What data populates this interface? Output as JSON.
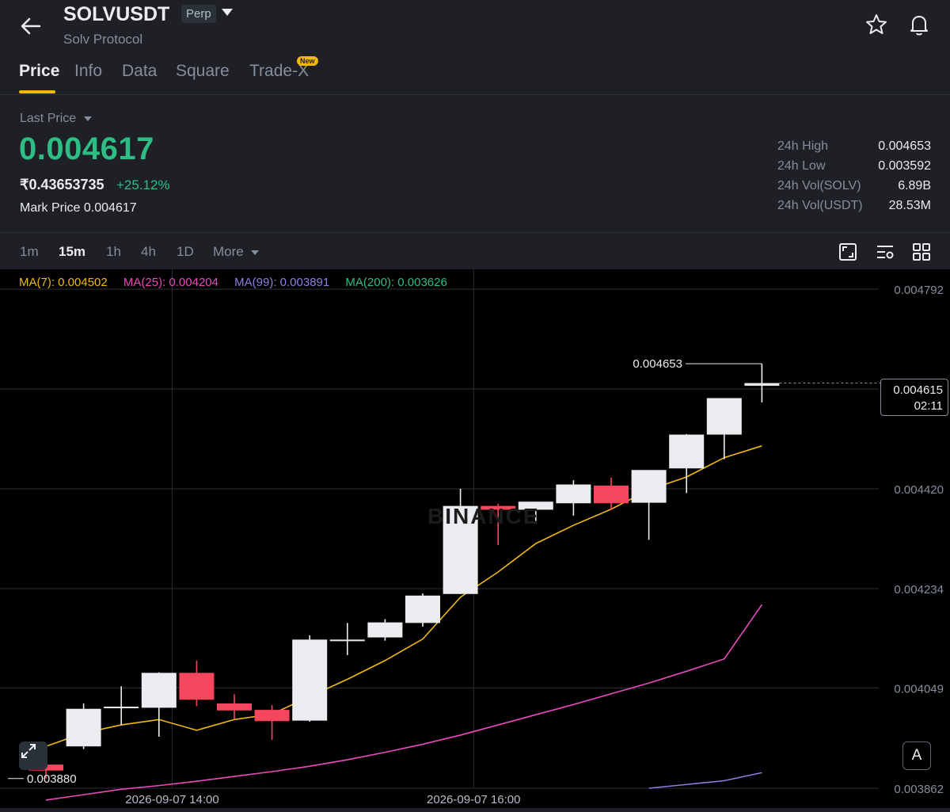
{
  "header": {
    "symbol": "SOLVUSDT",
    "badge": "Perp",
    "subname": "Solv Protocol"
  },
  "tabs": [
    {
      "label": "Price",
      "active": true
    },
    {
      "label": "Info",
      "active": false
    },
    {
      "label": "Data",
      "active": false
    },
    {
      "label": "Square",
      "active": false
    },
    {
      "label": "Trade-X",
      "active": false,
      "badge": "New"
    }
  ],
  "price": {
    "label": "Last Price",
    "last": "0.004617",
    "inr": "₹0.43653735",
    "change": "+25.12%",
    "mark_label": "Mark Price",
    "mark_value": "0.004617"
  },
  "stats": [
    {
      "label": "24h High",
      "value": "0.004653"
    },
    {
      "label": "24h Low",
      "value": "0.003592"
    },
    {
      "label": "24h Vol(SOLV)",
      "value": "6.89B"
    },
    {
      "label": "24h Vol(USDT)",
      "value": "28.53M"
    }
  ],
  "intervals": [
    {
      "label": "1m",
      "active": false
    },
    {
      "label": "15m",
      "active": true
    },
    {
      "label": "1h",
      "active": false
    },
    {
      "label": "4h",
      "active": false
    },
    {
      "label": "1D",
      "active": false
    },
    {
      "label": "More",
      "active": false
    }
  ],
  "ma_legend": [
    {
      "label": "MA(7): 0.004502",
      "color": "#f0b90b"
    },
    {
      "label": "MA(25): 0.004204",
      "color": "#e94bbd"
    },
    {
      "label": "MA(99): 0.003891",
      "color": "#8c7fe0"
    },
    {
      "label": "MA(200): 0.003626",
      "color": "#2ebd85"
    }
  ],
  "colors": {
    "up": "#eaecef",
    "down": "#f6465d",
    "ma7": "#f0b90b",
    "ma25": "#e94bbd",
    "ma99": "#8c7fe0"
  },
  "watermark": "BINANCE",
  "current_price": {
    "value": "0.004615",
    "countdown": "02:11"
  },
  "annotations": {
    "high": "0.004653",
    "low": "0.003880"
  },
  "a_button": "A",
  "chart_data": {
    "type": "candlestick",
    "interval": "15m",
    "ylim": [
      0.003862,
      0.004792
    ],
    "y_ticks": [
      "0.004792",
      "0.004420",
      "0.004234",
      "0.004049",
      "0.003862"
    ],
    "x_ticks": [
      "2026-09-07 14:00",
      "2026-09-07 16:00"
    ],
    "candles": [
      {
        "o": 0.003906,
        "h": 0.003906,
        "l": 0.00388,
        "c": 0.003895
      },
      {
        "o": 0.00394,
        "h": 0.00402,
        "l": 0.003935,
        "c": 0.00401
      },
      {
        "o": 0.004012,
        "h": 0.004052,
        "l": 0.00398,
        "c": 0.004014
      },
      {
        "o": 0.004012,
        "h": 0.004078,
        "l": 0.003958,
        "c": 0.004077
      },
      {
        "o": 0.004077,
        "h": 0.0041,
        "l": 0.004015,
        "c": 0.004027
      },
      {
        "o": 0.00402,
        "h": 0.004037,
        "l": 0.00399,
        "c": 0.004007
      },
      {
        "o": 0.004008,
        "h": 0.004017,
        "l": 0.003952,
        "c": 0.003987
      },
      {
        "o": 0.003988,
        "h": 0.004147,
        "l": 0.003986,
        "c": 0.004139
      },
      {
        "o": 0.004137,
        "h": 0.00417,
        "l": 0.00411,
        "c": 0.004139
      },
      {
        "o": 0.004143,
        "h": 0.004177,
        "l": 0.004137,
        "c": 0.004171
      },
      {
        "o": 0.00417,
        "h": 0.004225,
        "l": 0.004163,
        "c": 0.004221
      },
      {
        "o": 0.004224,
        "h": 0.00442,
        "l": 0.004224,
        "c": 0.004388
      },
      {
        "o": 0.004388,
        "h": 0.004392,
        "l": 0.004315,
        "c": 0.004381
      },
      {
        "o": 0.004381,
        "h": 0.004396,
        "l": 0.00436,
        "c": 0.004396
      },
      {
        "o": 0.004393,
        "h": 0.004436,
        "l": 0.00437,
        "c": 0.004428
      },
      {
        "o": 0.004426,
        "h": 0.004441,
        "l": 0.00438,
        "c": 0.004393
      },
      {
        "o": 0.004394,
        "h": 0.004433,
        "l": 0.004325,
        "c": 0.004455
      },
      {
        "o": 0.004458,
        "h": 0.004522,
        "l": 0.004412,
        "c": 0.004521
      },
      {
        "o": 0.004521,
        "h": 0.004539,
        "l": 0.004475,
        "c": 0.004589
      },
      {
        "o": 0.004612,
        "h": 0.004653,
        "l": 0.004581,
        "c": 0.004617
      }
    ],
    "ma7": [
      0.00394,
      0.003965,
      0.00398,
      0.00399,
      0.00397,
      0.00399,
      0.004,
      0.004033,
      0.004065,
      0.0041,
      0.00414,
      0.004218,
      0.004265,
      0.004318,
      0.004352,
      0.004382,
      0.004418,
      0.004442,
      0.004478,
      0.0045
    ],
    "ma25": [
      0.00384,
      0.00385,
      0.00386,
      0.003867,
      0.003875,
      0.003884,
      0.003893,
      0.003903,
      0.003915,
      0.003929,
      0.003944,
      0.003961,
      0.00398,
      0.003999,
      0.004018,
      0.004038,
      0.004058,
      0.00408,
      0.004103,
      0.004204
    ],
    "ma99": [
      null,
      null,
      null,
      null,
      null,
      null,
      null,
      null,
      null,
      null,
      null,
      null,
      null,
      null,
      null,
      null,
      0.003862,
      0.003869,
      0.003876,
      0.003891
    ]
  }
}
